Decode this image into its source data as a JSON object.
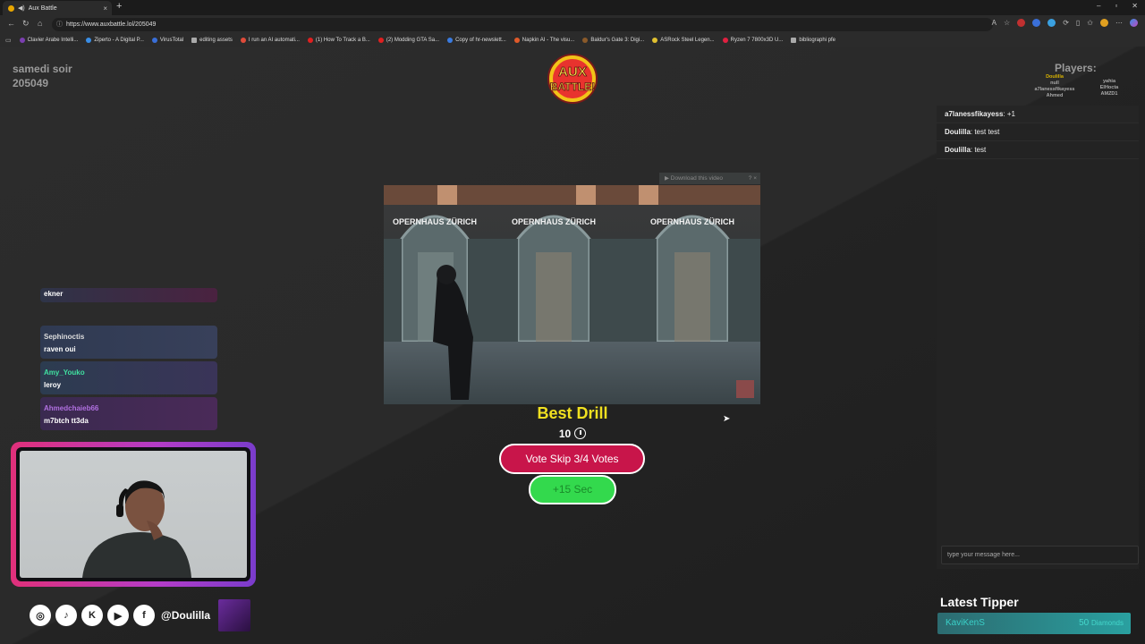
{
  "browser": {
    "tab_title": "Aux Battle",
    "new_tab": "+",
    "tab_close": "×",
    "window_controls": [
      "–",
      "▫",
      "✕"
    ],
    "url": "https://www.auxbattle.lol/205049",
    "bookmarks": [
      {
        "label": "Clavier Arabe Intelli...",
        "color": "#7b3fb0"
      },
      {
        "label": "Ziperto - A Digital P...",
        "color": "#3a8ee6"
      },
      {
        "label": "VirusTotal",
        "color": "#3a6fd8"
      },
      {
        "label": "editing assets",
        "color": "#aaaaaa"
      },
      {
        "label": "I run an AI automati...",
        "color": "#e04b3a"
      },
      {
        "label": "(1) How To Track a B...",
        "color": "#e02020"
      },
      {
        "label": "(2) Modding GTA Sa...",
        "color": "#e02020"
      },
      {
        "label": "Copy of hr-newslett...",
        "color": "#3a7be0"
      },
      {
        "label": "Napkin AI - The visu...",
        "color": "#e05a2a"
      },
      {
        "label": "Baldur's Gate 3: Digi...",
        "color": "#8a5a2a"
      },
      {
        "label": "ASRock Steel Legen...",
        "color": "#e0c030"
      },
      {
        "label": "Ryzen 7 7800x3D U...",
        "color": "#e02040"
      },
      {
        "label": "bibliographi pfe",
        "color": "#aaaaaa"
      }
    ]
  },
  "room": {
    "name": "samedi soir",
    "code": "205049"
  },
  "logo_text": [
    "AUX",
    "BATTLE!"
  ],
  "players": {
    "title": "Players:",
    "column1": [
      "Doulilla",
      "null",
      "a7lanessfikayess",
      "Ahmed"
    ],
    "column2": [
      "yahia",
      "ElHocta",
      "AMZD1"
    ]
  },
  "chat": {
    "messages": [
      {
        "user": "a7lanessfikayess",
        "text": ": +1"
      },
      {
        "user": "Doulilla",
        "text": ": test test"
      },
      {
        "user": "Doulilla",
        "text": ": test"
      }
    ],
    "input_placeholder": "type your message here..."
  },
  "video": {
    "download_label": "▶ Download this video",
    "download_close": "? ×",
    "sign_text": "OPERNHAUS ZÜRICH"
  },
  "round": {
    "category": "Best Drill",
    "timer": "10",
    "vote_skip": "Vote Skip 3/4 Votes",
    "add_time": "+15 Sec"
  },
  "overlay_chat": [
    {
      "user": "",
      "text": "ekner",
      "bg": "#4a2240"
    },
    {
      "user": "Sephinoctis",
      "text": "raven oui",
      "user_color": "#dddddd",
      "bg": "#2f3a52"
    },
    {
      "user": "Amy_Youko",
      "text": "leroy",
      "user_color": "#40e0a0",
      "bg": "#2c3c50"
    },
    {
      "user": "Ahmedchaieb66",
      "text": "m7btch tt3da",
      "user_color": "#b070e0",
      "bg": "#3a2a50"
    }
  ],
  "socials": {
    "icons": [
      "instagram-icon",
      "tiktok-icon",
      "kick-icon",
      "youtube-icon",
      "facebook-icon"
    ],
    "glyphs": [
      "◎",
      "♪",
      "K",
      "▶",
      "f"
    ],
    "handle": "@Doulilla"
  },
  "latest_tipper": {
    "title": "Latest Tipper",
    "name": "KaviKenS",
    "amount": "50",
    "unit": "Diamonds"
  }
}
